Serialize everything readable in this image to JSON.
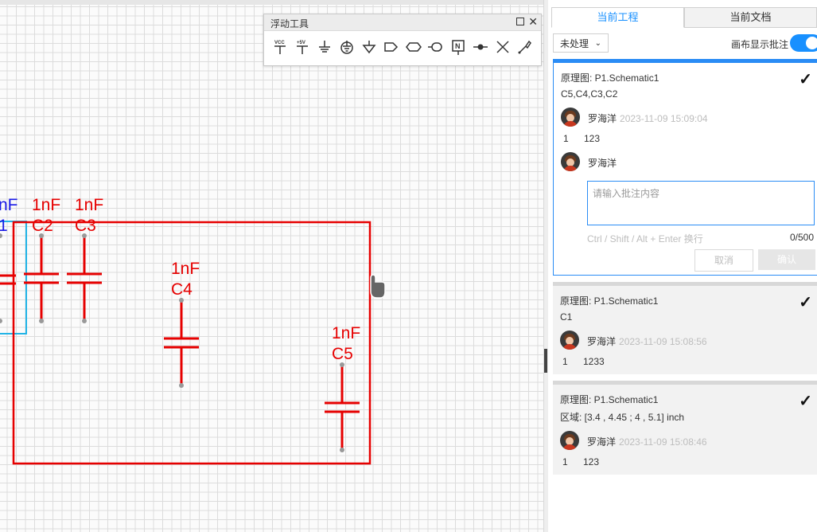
{
  "float_toolbar": {
    "title": "浮动工具",
    "icons": [
      "vcc-icon",
      "plus5v-icon",
      "ground-icon",
      "earth-ground-icon",
      "signal-ground-icon",
      "net-port-icon",
      "net-label-icon",
      "net-flag-icon",
      "no-connect-flag-icon",
      "wire-junction-icon",
      "x-mark-icon",
      "probe-icon"
    ],
    "vcc_text": "VCC",
    "plus5v_text": "+5V",
    "no_connect_text": "N"
  },
  "schematic": {
    "labels": {
      "c1_value": "nF",
      "c1_ref": "1",
      "c2_value": "1nF",
      "c2_ref": "C2",
      "c3_value": "1nF",
      "c3_ref": "C3",
      "c4_value": "1nF",
      "c4_ref": "C4",
      "c5_value": "1nF",
      "c5_ref": "C5"
    },
    "colors": {
      "component": "#e60000",
      "selected": "#1a1ae6",
      "highlight_box": "#22b4e6",
      "region": "#e60000"
    }
  },
  "panel": {
    "tabs": [
      {
        "label": "当前工程",
        "active": true
      },
      {
        "label": "当前文档",
        "active": false
      }
    ],
    "filter": {
      "selected": "未处理",
      "toggle_label": "画布显示批注",
      "toggle_on": true
    },
    "cards": [
      {
        "doc": "原理图: P1.Schematic1",
        "target": "C5,C4,C3,C2",
        "author": "罗海洋",
        "time": "2023-11-09 15:09:04",
        "replies": [
          {
            "num": "1",
            "text": "123"
          }
        ],
        "reply_author": "罗海洋",
        "input_placeholder": "请输入批注内容",
        "hint": "Ctrl / Shift / Alt + Enter 换行",
        "count": "0/500",
        "cancel_label": "取消",
        "confirm_label": "确认",
        "check": "✓"
      },
      {
        "doc": "原理图: P1.Schematic1",
        "target": "C1",
        "author": "罗海洋",
        "time": "2023-11-09 15:08:56",
        "replies": [
          {
            "num": "1",
            "text": "1233"
          }
        ],
        "check": "✓"
      },
      {
        "doc": "原理图: P1.Schematic1",
        "target": "区域: [3.4 , 4.45 ; 4 , 5.1] inch",
        "author": "罗海洋",
        "time": "2023-11-09 15:08:46",
        "replies": [
          {
            "num": "1",
            "text": "123"
          }
        ],
        "check": "✓"
      }
    ]
  }
}
